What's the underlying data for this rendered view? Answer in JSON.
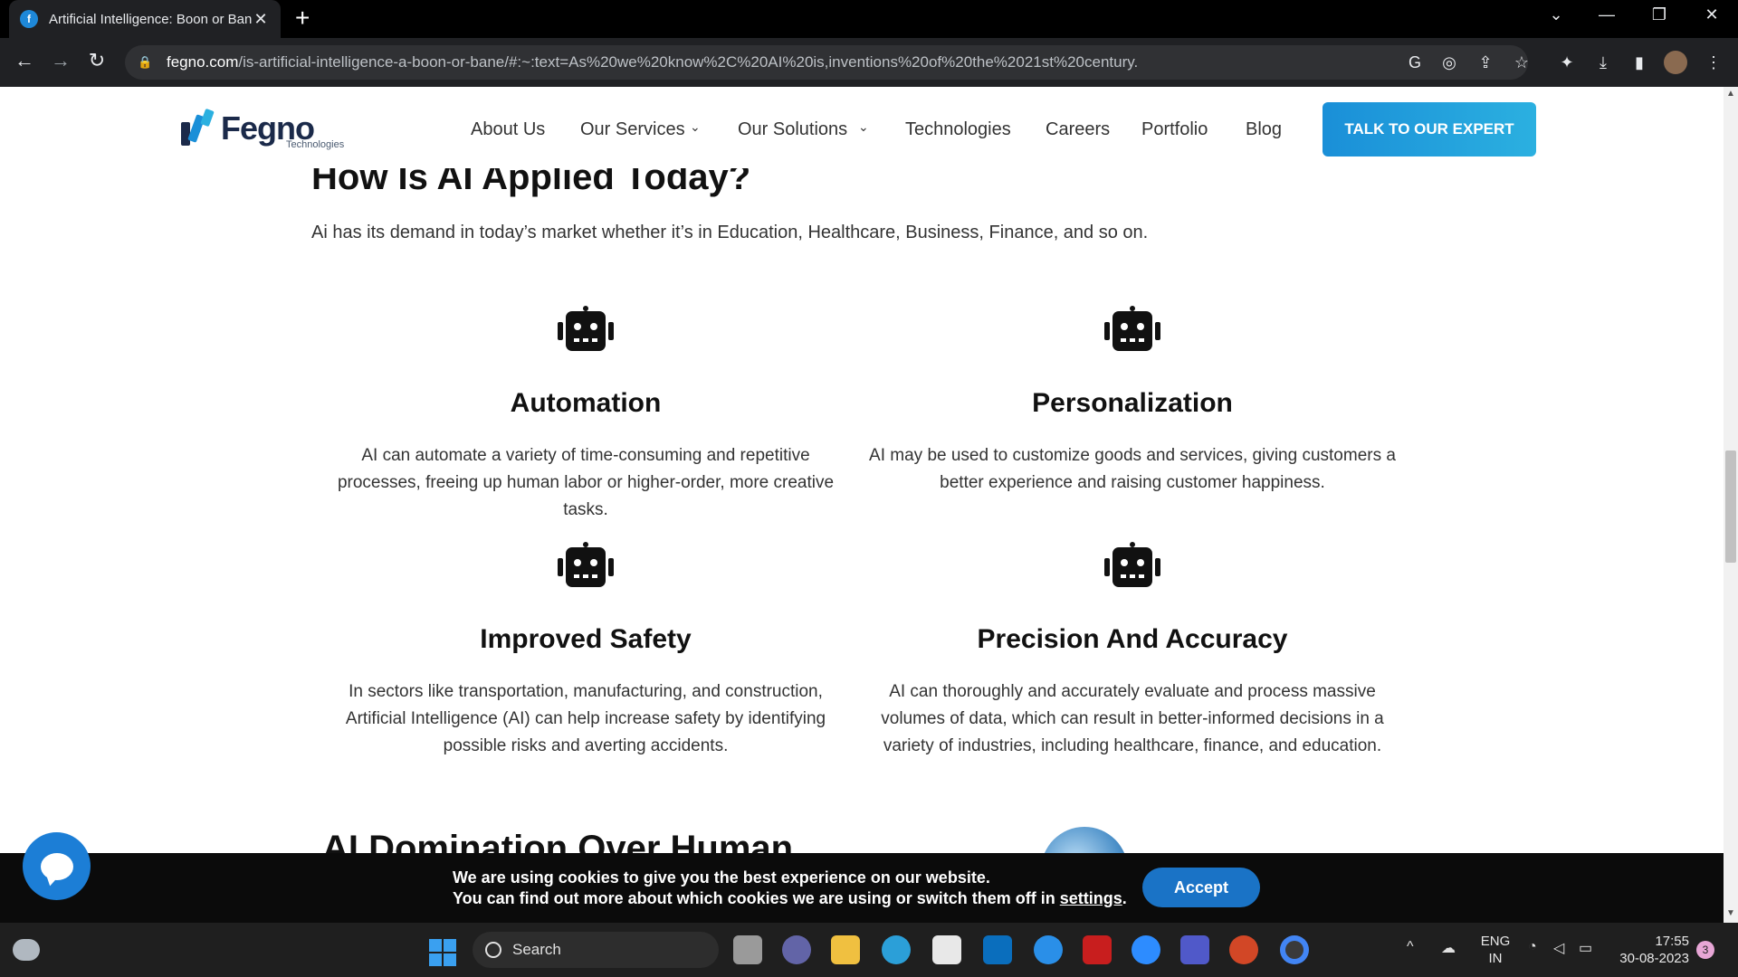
{
  "browser": {
    "tab_title": "Artificial Intelligence: Boon or Bane",
    "tab_close": "✕",
    "new_tab": "+",
    "url_host": "fegno.com",
    "url_path": "/is-artificial-intelligence-a-boon-or-bane/#:~:text=As%20we%20know%2C%20AI%20is,inventions%20of%20the%2021st%20century."
  },
  "header": {
    "logo_text": "Fegno",
    "logo_sub": "Technologies",
    "nav": [
      "About Us",
      "Our Services",
      "Our Solutions",
      "Technologies",
      "Careers",
      "Portfolio",
      "Blog"
    ],
    "cta_label": "TALK TO OUR EXPERT"
  },
  "main": {
    "heading": "How Is AI Applied Today?",
    "intro": "Ai has its demand in today’s market whether it’s in Education, Healthcare, Business,  Finance, and so on.",
    "cards": [
      {
        "icon": "robot-icon",
        "title": "Automation",
        "text": "AI can automate a variety of time-consuming and repetitive processes, freeing up human labor or higher-order, more creative tasks."
      },
      {
        "icon": "robot-icon",
        "title": "Personalization",
        "text": "AI may be used to customize goods and services, giving customers a better experience and raising customer happiness."
      },
      {
        "icon": "robot-icon",
        "title": "Improved Safety",
        "text": "In sectors like transportation, manufacturing, and construction, Artificial Intelligence (AI) can help increase safety by identifying possible risks and averting accidents."
      },
      {
        "icon": "robot-icon",
        "title": "Precision And Accuracy",
        "text": "AI can thoroughly and accurately evaluate and process massive volumes of data, which can result in better-informed decisions in a variety of industries, including healthcare, finance, and education."
      }
    ],
    "next_heading": "AI Domination Over Human"
  },
  "cookie": {
    "line1": "We are using cookies to give you the best experience on our website.",
    "line2_prefix": "You can find out more about which cookies we are using or switch them off in ",
    "line2_link": "settings",
    "line2_suffix": ".",
    "accept_label": "Accept"
  },
  "taskbar": {
    "search_label": "Search",
    "lang_top": "ENG",
    "lang_bottom": "IN",
    "time": "17:55",
    "date": "30-08-2023",
    "notification_count": "3"
  },
  "colors": {
    "brand_blue": "#1a8fd8",
    "cookie_bg": "#0b0b0b",
    "accept_blue": "#1a73c6"
  }
}
